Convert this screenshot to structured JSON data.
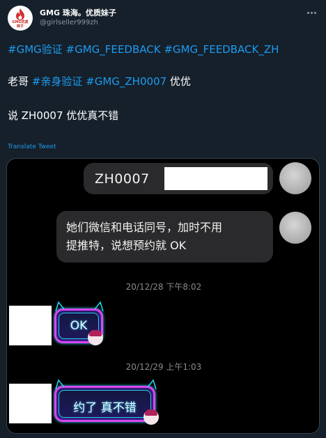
{
  "profile": {
    "display_name": "GMG 珠海。优质妹子",
    "handle": "@girlseller999zh",
    "avatar_text": "GMG优质\n妹子"
  },
  "tweet": {
    "line1": [
      "#GMG验证",
      " ",
      "#GMG_FEEDBACK",
      " ",
      "#GMG_FEEDBACK_ZH"
    ],
    "line2_prefix": "老哥 ",
    "line2_tag1": "#亲身验证",
    "line2_space": " ",
    "line2_tag2": "#GMG_ZH0007",
    "line2_suffix": " 优优",
    "line3": "说 ZH0007 优优真不错",
    "translate_label": "Translate Tweet"
  },
  "media": {
    "message1_code": "ZH0007",
    "message2": "她们微信和电话同号，加时不用\n提推特，说想预约就 OK",
    "timestamp1": "20/12/28 下午8:02",
    "sticker1_text": "OK",
    "timestamp2": "20/12/29 上午1:03",
    "sticker2_text": "约了 真不错"
  },
  "colors": {
    "background": "#15202b",
    "link": "#1d9bf0",
    "secondary_text": "#8899a6",
    "chat_bubble": "#2a2a2c"
  }
}
